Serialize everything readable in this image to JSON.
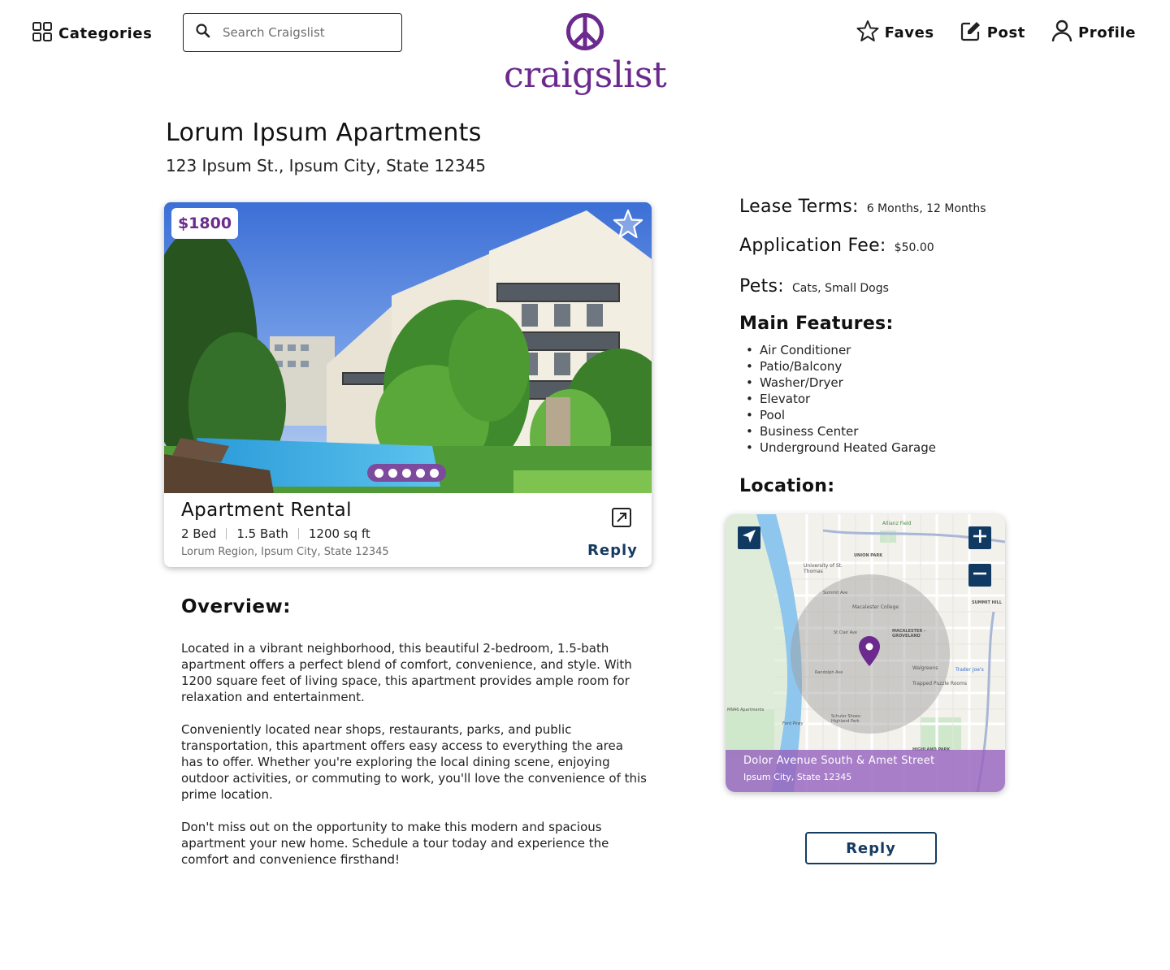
{
  "header": {
    "categories_label": "Categories",
    "search_placeholder": "Search Craigslist",
    "logo_text": "craigslist",
    "faves_label": "Faves",
    "post_label": "Post",
    "profile_label": "Profile"
  },
  "listing": {
    "title": "Lorum Ipsum Apartments",
    "address": "123 Ipsum St., Ipsum City, State 12345",
    "price": "$1800",
    "card_title": "Apartment Rental",
    "beds": "2 Bed",
    "baths": "1.5 Bath",
    "area": "1200 sq ft",
    "region": "Lorum Region, Ipsum City, State 12345",
    "reply_label": "Reply",
    "photo_count": 5
  },
  "overview": {
    "heading": "Overview:",
    "paragraphs": [
      "Located in a vibrant neighborhood, this beautiful 2-bedroom, 1.5-bath apartment offers a perfect blend of comfort, convenience, and style. With 1200 square feet of living space, this apartment provides ample room for relaxation and entertainment.",
      "Conveniently located near shops, restaurants, parks, and public transportation, this apartment offers easy access to everything the area has to offer. Whether you're exploring the local dining scene, enjoying outdoor activities, or commuting to work, you'll love the convenience of this prime location.",
      "Don't miss out on the opportunity to make this modern and spacious apartment your new home. Schedule a tour today and experience the comfort and convenience firsthand!"
    ]
  },
  "details": {
    "lease_label": "Lease Terms:",
    "lease_value": "6 Months, 12 Months",
    "fee_label": "Application Fee:",
    "fee_value": "$50.00",
    "pets_label": "Pets:",
    "pets_value": "Cats, Small Dogs",
    "features_heading": "Main Features:",
    "features": [
      "Air Conditioner",
      "Patio/Balcony",
      "Washer/Dryer",
      "Elevator",
      "Pool",
      "Business Center",
      "Underground Heated Garage"
    ],
    "location_heading": "Location:"
  },
  "map": {
    "street": "Dolor Avenue South & Amet Street",
    "city": "Ipsum City, State 12345",
    "labels": {
      "allianz": "Allianz Field",
      "union_park": "UNION PARK",
      "st_thomas": "University of St. Thomas",
      "summit_ave": "Summit Ave",
      "summit_hill": "SUMMIT HILL",
      "macalester_college": "Macalester College",
      "macalester_groveland": "MACALESTER - GROVELAND",
      "st_clair": "St Clair Ave",
      "randolph": "Randolph Ave",
      "walgreens": "Walgreens",
      "trader_joes": "Trader Joe's",
      "trapped_puzzle": "Trapped Puzzle Rooms",
      "mn46": "MN46 Apartments",
      "schuler": "Schuler Shoes: Highland Park",
      "ford_pkwy": "Ford Pkwy",
      "highland_park": "HIGHLAND PARK"
    }
  },
  "colors": {
    "brand_purple": "#6c2a8e",
    "navy": "#163b62",
    "map_overlay": "#9664be"
  },
  "icons": {
    "categories": "grid-icon",
    "search": "search-icon",
    "faves": "star-icon",
    "post": "edit-icon",
    "profile": "user-icon",
    "open": "external-link-icon"
  }
}
